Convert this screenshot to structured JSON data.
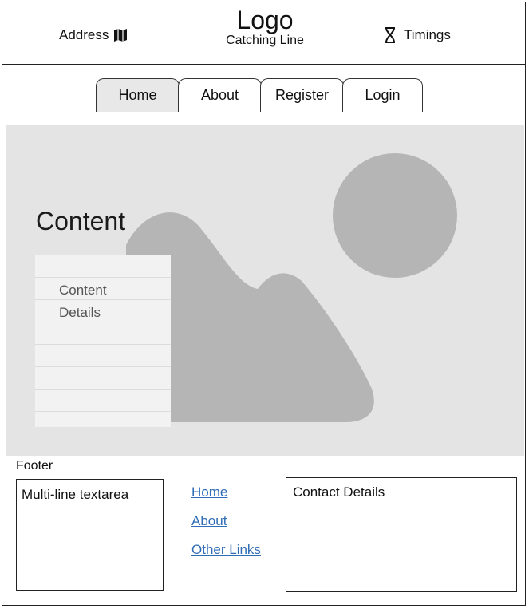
{
  "header": {
    "address_label": "Address",
    "address_icon": "map-icon",
    "logo": "Logo",
    "tagline": "Catching Line",
    "timings_label": "Timings",
    "timings_icon": "hourglass-icon"
  },
  "nav": {
    "tabs": [
      {
        "label": "Home",
        "active": true
      },
      {
        "label": "About",
        "active": false
      },
      {
        "label": "Register",
        "active": false
      },
      {
        "label": "Login",
        "active": false
      }
    ]
  },
  "hero": {
    "title": "Content",
    "details": "Content Details",
    "image_icon": "image-placeholder-icon",
    "colors": {
      "background": "#e4e4e4",
      "shapes": "#b5b5b5"
    }
  },
  "footer": {
    "label": "Footer",
    "textarea": "Multi-line textarea",
    "links": [
      "Home",
      "About",
      "Other Links"
    ],
    "contact": "Contact Details"
  },
  "colors": {
    "link": "#2f6db6",
    "active_tab": "#e8e8e8"
  }
}
